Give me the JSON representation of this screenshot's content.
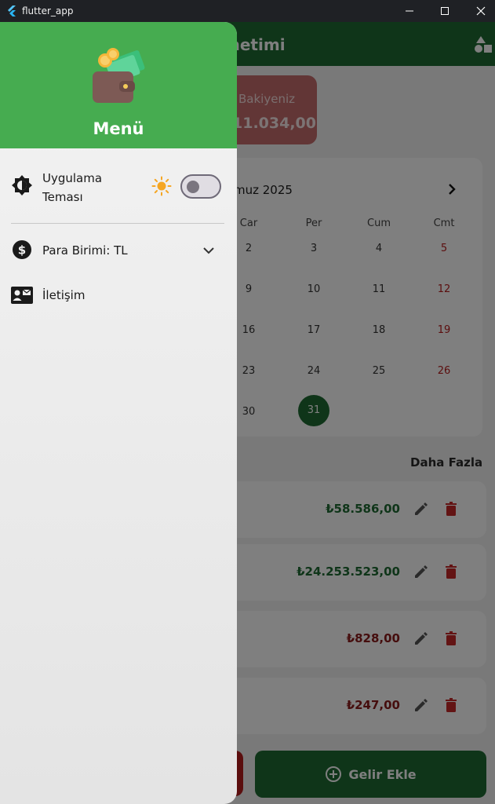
{
  "window": {
    "title": "flutter_app"
  },
  "appbar": {
    "title": "ler Yönetimi"
  },
  "balance": {
    "label": "Bakiyeniz",
    "value": "11.034,00"
  },
  "calendar": {
    "month": "muz 2025",
    "weekdays": [
      "Car",
      "Per",
      "Cum",
      "Cmt"
    ],
    "weeks": [
      [
        "2",
        "3",
        "4",
        "5"
      ],
      [
        "9",
        "10",
        "11",
        "12"
      ],
      [
        "16",
        "17",
        "18",
        "19"
      ],
      [
        "23",
        "24",
        "25",
        "26"
      ],
      [
        "30",
        "31",
        "",
        ""
      ]
    ],
    "today": "31"
  },
  "transactions": {
    "more_label": "Daha Fazla",
    "items": [
      {
        "amount": "₺58.586,00",
        "kind": "income"
      },
      {
        "amount": "₺24.253.523,00",
        "kind": "income"
      },
      {
        "amount": "₺828,00",
        "kind": "expense"
      },
      {
        "amount": "₺247,00",
        "kind": "expense"
      }
    ]
  },
  "actions": {
    "add_income_label": "Gelir Ekle"
  },
  "drawer": {
    "title": "Menü",
    "theme_label": "Uygulama Teması",
    "theme_dark": false,
    "currency_label": "Para Birimi: TL",
    "contact_label": "İletişim"
  },
  "colors": {
    "header_green": "#46ac50",
    "appbar_green": "#1e6b32",
    "expense_red": "#b71c1c",
    "sun_orange": "#f5a623"
  }
}
